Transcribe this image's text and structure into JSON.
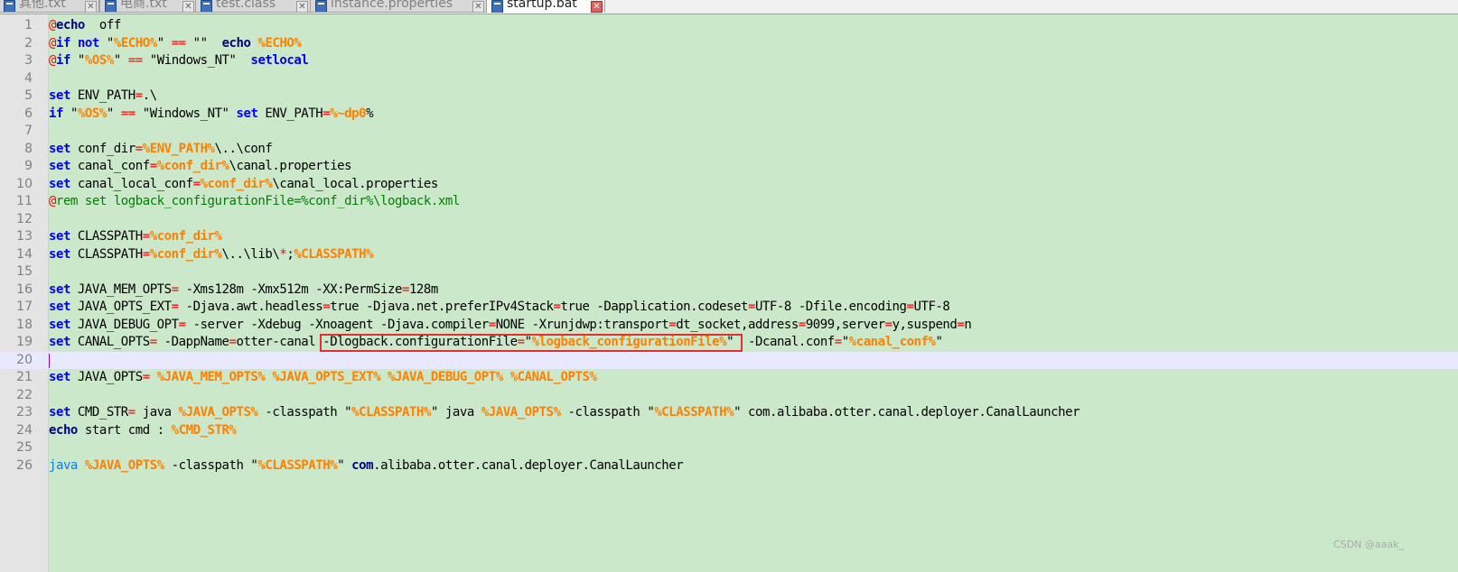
{
  "tabs": [
    {
      "label": "其他.txt",
      "active": false
    },
    {
      "label": "电商.txt",
      "active": false
    },
    {
      "label": "test.class",
      "active": false
    },
    {
      "label": "instance.properties",
      "active": false
    },
    {
      "label": "startup.bat",
      "active": true
    }
  ],
  "close_glyph": "✕",
  "current_line": 20,
  "highlighted_text": "-Dlogback.configurationFile=\"%logback_configurationFile%\"",
  "lines": [
    {
      "n": "1",
      "tokens": [
        [
          "at",
          "@"
        ],
        [
          "ech",
          "echo"
        ],
        [
          "",
          "  off"
        ]
      ]
    },
    {
      "n": "2",
      "tokens": [
        [
          "at",
          "@"
        ],
        [
          "kw",
          "if"
        ],
        [
          "",
          " "
        ],
        [
          "kw",
          "not"
        ],
        [
          "",
          " \""
        ],
        [
          "var",
          "%ECHO%"
        ],
        [
          "",
          "\" "
        ],
        [
          "op",
          "=="
        ],
        [
          "",
          " \"\"  "
        ],
        [
          "ech",
          "echo"
        ],
        [
          "",
          " "
        ],
        [
          "var",
          "%ECHO%"
        ]
      ]
    },
    {
      "n": "3",
      "tokens": [
        [
          "at",
          "@"
        ],
        [
          "kw",
          "if"
        ],
        [
          "",
          " \""
        ],
        [
          "var",
          "%OS%"
        ],
        [
          "",
          "\" "
        ],
        [
          "op",
          "=="
        ],
        [
          "",
          " \"Windows_NT\"  "
        ],
        [
          "kw",
          "setlocal"
        ]
      ]
    },
    {
      "n": "4",
      "tokens": []
    },
    {
      "n": "5",
      "tokens": [
        [
          "kw",
          "set"
        ],
        [
          "",
          " ENV_PATH"
        ],
        [
          "op",
          "="
        ],
        [
          "",
          ".\\"
        ]
      ]
    },
    {
      "n": "6",
      "tokens": [
        [
          "kw",
          "if"
        ],
        [
          "",
          " \""
        ],
        [
          "var",
          "%OS%"
        ],
        [
          "",
          "\" "
        ],
        [
          "op",
          "=="
        ],
        [
          "",
          " \"Windows_NT\" "
        ],
        [
          "kw",
          "set"
        ],
        [
          "",
          " ENV_PATH"
        ],
        [
          "op",
          "="
        ],
        [
          "var",
          "%~dp0"
        ],
        [
          "",
          "%"
        ]
      ]
    },
    {
      "n": "7",
      "tokens": []
    },
    {
      "n": "8",
      "tokens": [
        [
          "kw",
          "set"
        ],
        [
          "",
          " conf_dir"
        ],
        [
          "op",
          "="
        ],
        [
          "var",
          "%ENV_PATH%"
        ],
        [
          "",
          "\\..\\conf"
        ]
      ]
    },
    {
      "n": "9",
      "tokens": [
        [
          "kw",
          "set"
        ],
        [
          "",
          " canal_conf"
        ],
        [
          "op",
          "="
        ],
        [
          "var",
          "%conf_dir%"
        ],
        [
          "",
          "\\canal.properties"
        ]
      ]
    },
    {
      "n": "10",
      "tokens": [
        [
          "kw",
          "set"
        ],
        [
          "",
          " canal_local_conf"
        ],
        [
          "op",
          "="
        ],
        [
          "var",
          "%conf_dir%"
        ],
        [
          "",
          "\\canal_local.properties"
        ]
      ]
    },
    {
      "n": "11",
      "tokens": [
        [
          "at",
          "@"
        ],
        [
          "cmt",
          "rem set logback_configurationFile=%conf_dir%\\logback.xml"
        ]
      ]
    },
    {
      "n": "12",
      "tokens": []
    },
    {
      "n": "13",
      "tokens": [
        [
          "kw",
          "set"
        ],
        [
          "",
          " CLASSPATH"
        ],
        [
          "op",
          "="
        ],
        [
          "var",
          "%conf_dir%"
        ]
      ]
    },
    {
      "n": "14",
      "tokens": [
        [
          "kw",
          "set"
        ],
        [
          "",
          " CLASSPATH"
        ],
        [
          "op",
          "="
        ],
        [
          "var",
          "%conf_dir%"
        ],
        [
          "",
          "\\..\\lib\\"
        ],
        [
          "op",
          "*"
        ],
        [
          "",
          ";"
        ],
        [
          "var",
          "%CLASSPATH%"
        ]
      ]
    },
    {
      "n": "15",
      "tokens": []
    },
    {
      "n": "16",
      "tokens": [
        [
          "kw",
          "set"
        ],
        [
          "",
          " JAVA_MEM_OPTS"
        ],
        [
          "op",
          "="
        ],
        [
          "",
          " -Xms128m -Xmx512m -XX:PermSize"
        ],
        [
          "op",
          "="
        ],
        [
          "",
          "128m"
        ]
      ]
    },
    {
      "n": "17",
      "tokens": [
        [
          "kw",
          "set"
        ],
        [
          "",
          " JAVA_OPTS_EXT"
        ],
        [
          "op",
          "="
        ],
        [
          "",
          " -Djava.awt.headless"
        ],
        [
          "op",
          "="
        ],
        [
          "",
          "true -Djava.net.preferIPv4Stack"
        ],
        [
          "op",
          "="
        ],
        [
          "",
          "true -Dapplication.codeset"
        ],
        [
          "op",
          "="
        ],
        [
          "",
          "UTF-8 -Dfile.encoding"
        ],
        [
          "op",
          "="
        ],
        [
          "",
          "UTF-8"
        ]
      ]
    },
    {
      "n": "18",
      "tokens": [
        [
          "kw",
          "set"
        ],
        [
          "",
          " JAVA_DEBUG_OPT"
        ],
        [
          "op",
          "="
        ],
        [
          "",
          " -server -Xdebug -Xnoagent -Djava.compiler"
        ],
        [
          "op",
          "="
        ],
        [
          "",
          "NONE -Xrunjdwp:transport"
        ],
        [
          "op",
          "="
        ],
        [
          "",
          "dt_socket,address"
        ],
        [
          "op",
          "="
        ],
        [
          "",
          "9099,server"
        ],
        [
          "op",
          "="
        ],
        [
          "",
          "y,suspend"
        ],
        [
          "op",
          "="
        ],
        [
          "",
          "n"
        ]
      ]
    },
    {
      "n": "19",
      "tokens": [
        [
          "kw",
          "set"
        ],
        [
          "",
          " CANAL_OPTS"
        ],
        [
          "op",
          "="
        ],
        [
          "",
          " -DappName"
        ],
        [
          "op",
          "="
        ],
        [
          "",
          "otter-canal "
        ],
        [
          "hl-start",
          ""
        ],
        [
          "",
          "-Dlogback.configurationFile"
        ],
        [
          "op",
          "="
        ],
        [
          "",
          "\""
        ],
        [
          "var",
          "%logback_configurationFile%"
        ],
        [
          "",
          "\" "
        ],
        [
          "hl-end",
          ""
        ],
        [
          "",
          " -Dcanal.conf"
        ],
        [
          "op",
          "="
        ],
        [
          "",
          "\""
        ],
        [
          "var",
          "%canal_conf%"
        ],
        [
          "",
          "\""
        ]
      ]
    },
    {
      "n": "20",
      "tokens": []
    },
    {
      "n": "21",
      "tokens": [
        [
          "kw",
          "set"
        ],
        [
          "",
          " JAVA_OPTS"
        ],
        [
          "op",
          "="
        ],
        [
          "",
          " "
        ],
        [
          "var",
          "%JAVA_MEM_OPTS%"
        ],
        [
          "",
          " "
        ],
        [
          "var",
          "%JAVA_OPTS_EXT%"
        ],
        [
          "",
          " "
        ],
        [
          "var",
          "%JAVA_DEBUG_OPT%"
        ],
        [
          "",
          " "
        ],
        [
          "var",
          "%CANAL_OPTS%"
        ]
      ]
    },
    {
      "n": "22",
      "tokens": []
    },
    {
      "n": "23",
      "tokens": [
        [
          "kw",
          "set"
        ],
        [
          "",
          " CMD_STR"
        ],
        [
          "op",
          "="
        ],
        [
          "",
          " java "
        ],
        [
          "var",
          "%JAVA_OPTS%"
        ],
        [
          "",
          " -classpath \""
        ],
        [
          "var",
          "%CLASSPATH%"
        ],
        [
          "",
          "\" java "
        ],
        [
          "var",
          "%JAVA_OPTS%"
        ],
        [
          "",
          " -classpath \""
        ],
        [
          "var",
          "%CLASSPATH%"
        ],
        [
          "",
          "\" com.alibaba.otter.canal.deployer.CanalLauncher"
        ]
      ]
    },
    {
      "n": "24",
      "tokens": [
        [
          "ech",
          "echo"
        ],
        [
          "",
          " start cmd : "
        ],
        [
          "var",
          "%CMD_STR%"
        ]
      ]
    },
    {
      "n": "25",
      "tokens": []
    },
    {
      "n": "26",
      "tokens": [
        [
          "java",
          "java"
        ],
        [
          "",
          " "
        ],
        [
          "var",
          "%JAVA_OPTS%"
        ],
        [
          "",
          " -classpath \""
        ],
        [
          "var",
          "%CLASSPATH%"
        ],
        [
          "",
          "\" "
        ],
        [
          "ech",
          "com"
        ],
        [
          "",
          ".alibaba.otter.canal.deployer.CanalLauncher"
        ]
      ]
    }
  ],
  "watermark": "CSDN @aaak_"
}
